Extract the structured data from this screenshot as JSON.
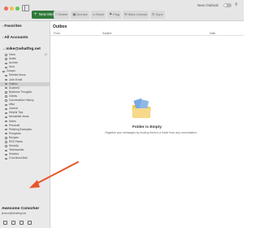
{
  "topbar": {
    "new_message": "New Message",
    "toolbar": [
      {
        "label": "Delete",
        "icon": "trash-icon"
      },
      {
        "label": "Archive",
        "icon": "archive-icon"
      },
      {
        "label": "Move",
        "icon": "move-icon"
      },
      {
        "label": "Flag",
        "icon": "flag-icon"
      },
      {
        "label": "Mark Unread",
        "icon": "envelope-icon"
      },
      {
        "label": "Sync",
        "icon": "sync-icon"
      }
    ],
    "new_outlook": "New Outlook"
  },
  "sidebar": {
    "favorites": "Favorites",
    "all_accounts": "All Accounts",
    "account_email": "mike@whatfng.net",
    "items": [
      {
        "label": "Inbox",
        "count": "11"
      },
      {
        "label": "Drafts",
        "count": ""
      },
      {
        "label": "Archive",
        "count": ""
      },
      {
        "label": "Sent",
        "count": ""
      },
      {
        "label": "Groups",
        "count": ""
      },
      {
        "label": "Deleted Items",
        "count": ""
      },
      {
        "label": "Junk Email",
        "count": ""
      },
      {
        "label": "Outbox",
        "count": ""
      },
      {
        "label": "Scanned",
        "count": ""
      },
      {
        "label": "Business Thoughts",
        "count": ""
      },
      {
        "label": "Clients",
        "count": ""
      },
      {
        "label": "Conversation History",
        "count": ""
      },
      {
        "label": "eBar",
        "count": ""
      },
      {
        "label": "Journal",
        "count": ""
      },
      {
        "label": "Helpful Tips",
        "count": ""
      },
      {
        "label": "Newsletter Ideas",
        "count": ""
      },
      {
        "label": "Notes",
        "count": ""
      },
      {
        "label": "Personal",
        "count": ""
      },
      {
        "label": "Phishing Examples",
        "count": ""
      },
      {
        "label": "Prospects",
        "count": ""
      },
      {
        "label": "Recipes",
        "count": ""
      },
      {
        "label": "RSS Feeds",
        "count": ""
      },
      {
        "label": "Security",
        "count": ""
      },
      {
        "label": "Testimonials",
        "count": ""
      },
      {
        "label": "Vendors",
        "count": ""
      },
      {
        "label": "Z Archived Mail",
        "count": ""
      }
    ],
    "selected": "Outbox",
    "bottom_account_name": "Awesome Comorker",
    "bottom_account_email": "jenson@whatfng.net"
  },
  "main": {
    "folder_title": "Outbox",
    "columns": {
      "from": "From",
      "subject": "Subject",
      "date": "Date"
    },
    "empty_title": "Folder is Empty",
    "empty_sub": "Organize your messages by moving them to a folder from any conversation."
  },
  "colors": {
    "accent": "#2f7a3b",
    "arrow": "#e8552a",
    "folder_back": "#f5c654",
    "folder_front": "#f7d98a",
    "folder_paper": "#79a9e0"
  }
}
